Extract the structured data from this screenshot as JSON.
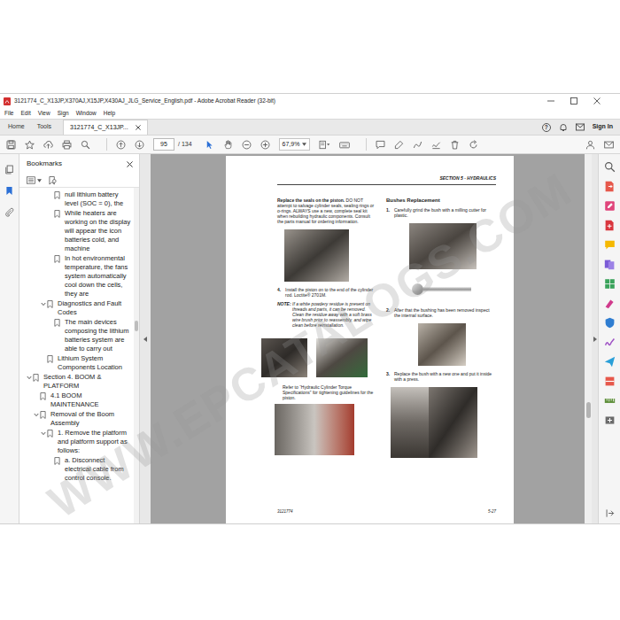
{
  "window": {
    "title": "3121774_C_X13JP,X370AJ,X15JP,X430AJ_JLG_Service_English.pdf - Adobe Acrobat Reader (32-bit)"
  },
  "menu": [
    "File",
    "Edit",
    "View",
    "Sign",
    "Window",
    "Help"
  ],
  "tabs": [
    {
      "label": "Home",
      "selected": false
    },
    {
      "label": "Tools",
      "selected": false
    },
    {
      "label": "3121774_C_X13JP...",
      "selected": true
    }
  ],
  "account": {
    "help": "?",
    "sign_in": "Sign In"
  },
  "toolbar": {
    "page": "95",
    "page_total": "/ 134",
    "zoom": "67,9%"
  },
  "bookmarks": {
    "title": "Bookmarks",
    "items": [
      {
        "text": "null lithium battery level (SOC = 0), the",
        "depth": 3
      },
      {
        "text": "While heaters are working on the display will appear the icon batteries cold, and machine",
        "depth": 3
      },
      {
        "text": "In hot environmental temperature, the fans system automatically cool down the cells, they are",
        "depth": 3
      },
      {
        "text": "Diagnostics and Fault Codes",
        "depth": 2,
        "expanded": true
      },
      {
        "text": "The main devices composing the lithium batteries system are able to carry out",
        "depth": 3
      },
      {
        "text": "Lithium System Components Location",
        "depth": 2
      },
      {
        "text": "Section 4. BOOM & PLATFORM",
        "depth": 0,
        "expanded": true
      },
      {
        "text": "4.1 BOOM MAINTENANCE",
        "depth": 1
      },
      {
        "text": "Removal of the Boom Assembly",
        "depth": 1,
        "expanded": true
      },
      {
        "text": "1. Remove the platform and platform support as follows:",
        "depth": 2,
        "expanded": true
      },
      {
        "text": "a. Disconnect electrical cable from control console.",
        "depth": 3
      }
    ]
  },
  "document": {
    "header": "SECTION 5 - HYDRAULICS",
    "intro_bold": "Replace the seals on the piston.",
    "intro": "DO NOT attempt to salvage cylinder seals, sealing rings or o-rings. ALWAYS use a new, complete seal kit when rebuilding hydraulic components. Consult the parts manual for ordering information.",
    "step4": {
      "number": "4.",
      "text": "Install the piston on to the end of the cylinder rod. Loctite® 2701M."
    },
    "note": {
      "label": "NOTE:",
      "text": "If a white powdery residue is present on threads and parts, it can be removed. Clean the residue away with a soft brass wire brush prior to reassembly, and wipe clean before reinstallation."
    },
    "refer": "Refer to “Hydraulic Cylinder Torque Specifications” for tightening guidelines for the piston.",
    "right_heading": "Bushes Replacement",
    "steps": [
      {
        "number": "1.",
        "text": "Carefully grind the bush with a milling cutter for plastic."
      },
      {
        "number": "2.",
        "text": "After that the bushing has been removed inspect the internal surface."
      },
      {
        "number": "3.",
        "text": "Replace the bush with a new one and put it inside with a press."
      }
    ],
    "footer_left": "3121774",
    "footer_right": "5-27"
  },
  "watermark": "WWW.EPCATALOGS.COM"
}
